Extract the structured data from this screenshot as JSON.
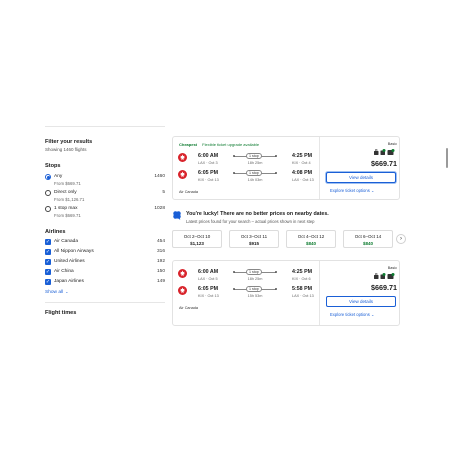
{
  "sidebar": {
    "title": "Filter your results",
    "subtitle": "Showing 1460 flights",
    "stops": {
      "heading": "Stops",
      "options": [
        {
          "label": "Any",
          "count": "1460",
          "price": "From $669.71",
          "selected": true
        },
        {
          "label": "Direct only",
          "count": "5",
          "price": "From $1,126.71",
          "selected": false
        },
        {
          "label": "1 stop max",
          "count": "1028",
          "price": "From $669.71",
          "selected": false
        }
      ]
    },
    "airlines": {
      "heading": "Airlines",
      "options": [
        {
          "label": "Air Canada",
          "count": "454"
        },
        {
          "label": "All Nippon Airways",
          "count": "316"
        },
        {
          "label": "United Airlines",
          "count": "192"
        },
        {
          "label": "Air China",
          "count": "150"
        },
        {
          "label": "Japan Airlines",
          "count": "149"
        }
      ],
      "show_all": "Show all"
    },
    "flight_times": "Flight times"
  },
  "results": [
    {
      "tag_cheapest": "Cheapest",
      "tag_upgrade": "Flexible ticket upgrade available",
      "outbound": {
        "dep_time": "6:00 AM",
        "dep_sub": "LAX · Oct 3",
        "stops": "1 stop",
        "duration": "18h 25m",
        "arr_time": "4:25 PM",
        "arr_sub": "KIX · Oct 4"
      },
      "inbound": {
        "dep_time": "6:05 PM",
        "dep_sub": "KIX · Oct 13",
        "stops": "1 stop",
        "duration": "14h 03m",
        "arr_time": "4:08 PM",
        "arr_sub": "LAX · Oct 13"
      },
      "airline": "Air Canada",
      "fare_class": "Basic",
      "price": "$669.71",
      "view_label": "View details",
      "explore_label": "Explore ticket options"
    },
    {
      "outbound": {
        "dep_time": "6:00 AM",
        "dep_sub": "LAX · Oct 5",
        "stops": "1 stop",
        "duration": "18h 25m",
        "arr_time": "4:25 PM",
        "arr_sub": "KIX · Oct 6"
      },
      "inbound": {
        "dep_time": "6:05 PM",
        "dep_sub": "KIX · Oct 13",
        "stops": "1 stop",
        "duration": "15h 53m",
        "arr_time": "5:58 PM",
        "arr_sub": "LAX · Oct 13"
      },
      "airline": "Air Canada",
      "fare_class": "Basic",
      "price": "$669.71",
      "view_label": "View details",
      "explore_label": "Explore ticket options"
    }
  ],
  "lucky": {
    "title": "You're lucky! There are no better prices on nearby dates.",
    "subtitle": "Latest prices found for your search – actual prices shown in next step",
    "dates": [
      {
        "range": "Oct 2–Oct 10",
        "price": "$1,123",
        "green": false
      },
      {
        "range": "Oct 3–Oct 11",
        "price": "$915",
        "green": false
      },
      {
        "range": "Oct 4–Oct 12",
        "price": "$840",
        "green": true
      },
      {
        "range": "Oct 6–Oct 14",
        "price": "$840",
        "green": true
      }
    ],
    "next_arrow": "›"
  },
  "colors": {
    "accent": "#1a5fd6",
    "green": "#0b7a2e",
    "air_canada_red": "#d8222a"
  }
}
